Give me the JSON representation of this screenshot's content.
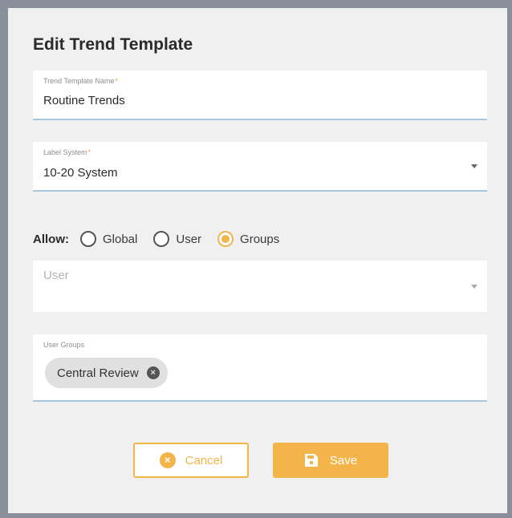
{
  "dialog": {
    "title": "Edit Trend Template"
  },
  "fields": {
    "template_name": {
      "label": "Trend Template Name",
      "required_mark": "*",
      "value": "Routine Trends"
    },
    "label_system": {
      "label": "Label System",
      "required_mark": "*",
      "value": "10-20 System"
    },
    "user": {
      "placeholder": "User"
    },
    "user_groups": {
      "label": "User Groups",
      "chips": [
        {
          "label": "Central Review"
        }
      ]
    }
  },
  "allow": {
    "label": "Allow:",
    "options": [
      {
        "label": "Global",
        "checked": false
      },
      {
        "label": "User",
        "checked": false
      },
      {
        "label": "Groups",
        "checked": true
      }
    ]
  },
  "buttons": {
    "cancel_label": "Cancel",
    "save_label": "Save"
  },
  "colors": {
    "accent": "#f3b54a",
    "field_underline_active": "#a7c7e0",
    "dialog_background": "#f0f0f0"
  },
  "icons": {
    "cancel": "cancel-circle-icon",
    "save": "floppy-disk-icon",
    "dropdown": "caret-down-icon",
    "chip_remove": "close-circle-icon"
  }
}
